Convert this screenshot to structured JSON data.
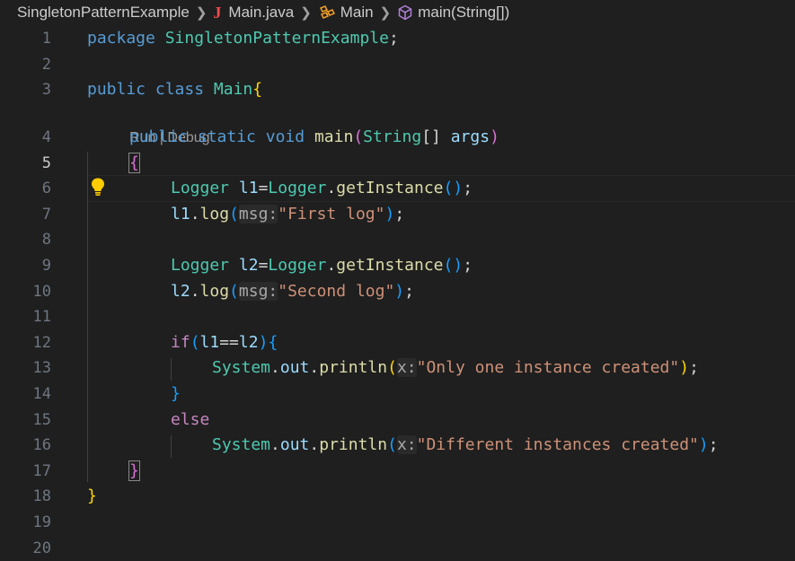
{
  "breadcrumb": {
    "project": "SingletonPatternExample",
    "file_icon": "J",
    "file": "Main.java",
    "class": "Main",
    "method": "main(String[])"
  },
  "codelens": {
    "run": "Run",
    "sep": " | ",
    "debug": "Debug"
  },
  "line_numbers": [
    "1",
    "2",
    "3",
    "4",
    "5",
    "6",
    "7",
    "8",
    "9",
    "10",
    "11",
    "12",
    "13",
    "14",
    "15",
    "16",
    "17",
    "18",
    "19",
    "20"
  ],
  "code": {
    "l1": [
      "package",
      " ",
      "SingletonPatternExample",
      ";"
    ],
    "l3": [
      "public",
      " ",
      "class",
      " ",
      "Main",
      "{"
    ],
    "l4": [
      "public",
      " ",
      "static",
      " ",
      "void",
      " ",
      "main",
      "(",
      "String",
      "[]",
      " ",
      "args",
      ")"
    ],
    "l5": [
      "{"
    ],
    "l6": [
      "Logger",
      " ",
      "l1",
      "=",
      "Logger",
      ".",
      "getInstance",
      "(",
      ")",
      ";"
    ],
    "l7": [
      "l1",
      ".",
      "log",
      "(",
      "msg:",
      "\"First log\"",
      ")",
      ";"
    ],
    "l9": [
      "Logger",
      " ",
      "l2",
      "=",
      "Logger",
      ".",
      "getInstance",
      "(",
      ")",
      ";"
    ],
    "l10": [
      "l2",
      ".",
      "log",
      "(",
      "msg:",
      "\"Second log\"",
      ")",
      ";"
    ],
    "l12": [
      "if",
      "(",
      "l1",
      "==",
      "l2",
      ")",
      "{"
    ],
    "l13": [
      "System",
      ".",
      "out",
      ".",
      "println",
      "(",
      "x:",
      "\"Only one instance created\"",
      ")",
      ";"
    ],
    "l14": [
      "}"
    ],
    "l15": [
      "else"
    ],
    "l16": [
      "System",
      ".",
      "out",
      ".",
      "println",
      "(",
      "x:",
      "\"Different instances created\"",
      ")",
      ";"
    ],
    "l17": [
      "}"
    ],
    "l18": [
      "}"
    ]
  },
  "active_line": "5",
  "colors": {
    "background": "#1f1f1f",
    "keyword": "#569cd6",
    "control": "#c586c0",
    "type": "#4ec9b0",
    "function": "#dcdcaa",
    "variable": "#9cdcfe",
    "string": "#ce9178",
    "bracket_gold": "#ffd700",
    "bracket_purple": "#da70d6",
    "bracket_blue": "#179fff"
  },
  "icons": {
    "lightbulb": "lightbulb-icon",
    "class": "class-icon",
    "method": "method-icon"
  }
}
